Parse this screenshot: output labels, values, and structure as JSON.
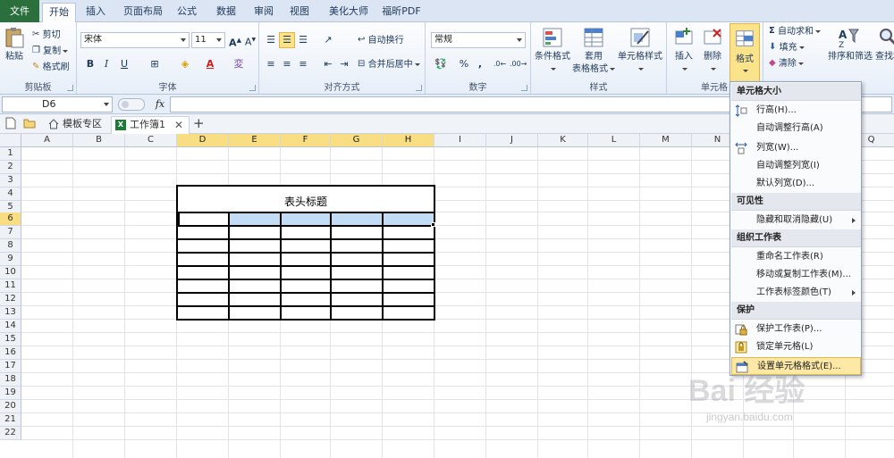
{
  "ribbon_tabs": [
    "文件",
    "开始",
    "插入",
    "页面布局",
    "公式",
    "数据",
    "审阅",
    "视图",
    "美化大师",
    "福昕PDF"
  ],
  "ribbon": {
    "clipboard": {
      "paste": "粘贴",
      "cut": "剪切",
      "copy": "复制",
      "painter": "格式刷",
      "label": "剪贴板"
    },
    "font": {
      "name": "宋体",
      "size": "11",
      "label": "字体"
    },
    "align": {
      "wrap": "自动换行",
      "merge": "合并后居中",
      "label": "对齐方式"
    },
    "number": {
      "format": "常规",
      "label": "数字"
    },
    "styles": {
      "cond": "条件格式",
      "table1": "套用",
      "table2": "表格格式",
      "cell": "单元格样式",
      "label": "样式"
    },
    "cells": {
      "insert": "插入",
      "delete": "删除",
      "format": "格式",
      "label": "单元格"
    },
    "edit": {
      "autosum": "自动求和",
      "fill": "填充",
      "clear": "清除",
      "sort": "排序和筛选",
      "find": "查找和"
    }
  },
  "formula": {
    "cell_ref": "D6",
    "fx": "fx",
    "value": ""
  },
  "doc_tabs": {
    "templates": "模板专区",
    "workbook": "工作簿1"
  },
  "columns": [
    "A",
    "B",
    "C",
    "D",
    "E",
    "F",
    "G",
    "H",
    "I",
    "J",
    "K",
    "L",
    "M",
    "N",
    "O",
    "P",
    "Q"
  ],
  "rows": [
    "1",
    "2",
    "3",
    "4",
    "5",
    "6",
    "7",
    "8",
    "9",
    "10",
    "11",
    "12",
    "13",
    "14",
    "15",
    "16",
    "17",
    "18",
    "19",
    "20",
    "21",
    "22"
  ],
  "table": {
    "title": "表头标题"
  },
  "menu": {
    "h1": "单元格大小",
    "row_height": "行高(H)...",
    "auto_row": "自动调整行高(A)",
    "col_width": "列宽(W)...",
    "auto_col": "自动调整列宽(I)",
    "default_width": "默认列宽(D)...",
    "h2": "可见性",
    "hide": "隐藏和取消隐藏(U)",
    "h3": "组织工作表",
    "rename": "重命名工作表(R)",
    "move": "移动或复制工作表(M)...",
    "tab_color": "工作表标签颜色(T)",
    "h4": "保护",
    "protect": "保护工作表(P)...",
    "lock": "锁定单元格(L)",
    "format_cells": "设置单元格格式(E)..."
  },
  "watermark": {
    "main": "Bai 经验",
    "sub": "jingyan.baidu.com"
  }
}
